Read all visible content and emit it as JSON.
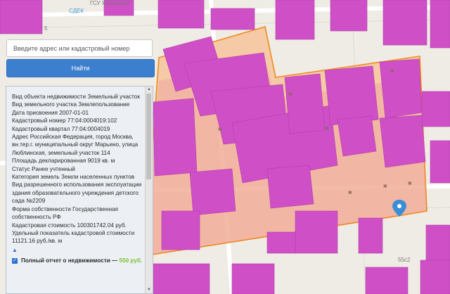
{
  "map": {
    "labels": {
      "top_street": "ГСУ Жилищник",
      "sdek": "СДЕК",
      "building_a": "5",
      "building_b": "55с2"
    },
    "colors": {
      "background": "#efece6",
      "building": "#cf50c6",
      "building_stroke": "#b13ca8",
      "parcel_fill": "#f7c49a",
      "parcel_border": "#f08a1c",
      "highlight_overlay": "#d8329e",
      "marker": "#3a8ed8"
    }
  },
  "search": {
    "placeholder": "Введите адрес или кадастровый номер",
    "button_label": "Найти"
  },
  "info": {
    "lines": [
      "Вид объекта недвижимости Земельный участок",
      "Вид земельного участка Землепользование",
      "Дата присвоения 2007-01-01",
      "Кадастровый номер 77:04:0004019:102",
      "Кадастровый квартал 77:04:0004019",
      "Адрес Российская Федерация, город Москва, вн.тер.г. муниципальный округ Марьино, улица Люблинская, земельный участок 114",
      "Площадь декларированная 9019 кв. м",
      "Статус Ранее учтенный",
      "Категория земель Земли населенных пунктов",
      "Вид разрешенного использования эксплуатации здания образовательного учреждения детского сада №2209",
      "Форма собственности Государственная собственность РФ",
      "Кадастровая стоимость 100301742.04 руб.",
      "Удельный показатель кадастровой стоимости 11121.16 руб./кв. м"
    ],
    "collapse_arrow": "▲",
    "report_label": "Полный отчет о недвижимости — ",
    "report_price": "550 руб."
  }
}
